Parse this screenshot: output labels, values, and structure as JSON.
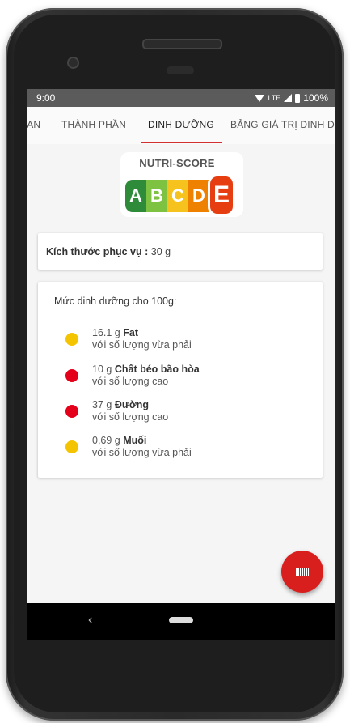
{
  "status_bar": {
    "time": "9:00",
    "network": "LTE",
    "battery": "100%"
  },
  "tabs": [
    {
      "label": "JAN"
    },
    {
      "label": "THÀNH PHẦN"
    },
    {
      "label": "DINH DƯỠNG",
      "active": true
    },
    {
      "label": "BẢNG GIÁ TRỊ DINH DƯ"
    }
  ],
  "nutriscore": {
    "title": "NUTRI-SCORE",
    "grades": [
      "A",
      "B",
      "C",
      "D",
      "E"
    ],
    "selected": "E"
  },
  "serving": {
    "label": "Kích thước phục vụ :",
    "value": "30 g"
  },
  "levels": {
    "title": "Mức dinh dưỡng cho 100g:",
    "items": [
      {
        "amount": "16.1 g",
        "nutrient": "Fat",
        "level_text": "với số lượng vừa phải",
        "level": "moderate",
        "color": "#f5c400"
      },
      {
        "amount": "10 g",
        "nutrient": "Chất béo bão hòa",
        "level_text": "với số lượng cao",
        "level": "high",
        "color": "#e4001b"
      },
      {
        "amount": "37 g",
        "nutrient": "Đường",
        "level_text": "với số lượng cao",
        "level": "high",
        "color": "#e4001b"
      },
      {
        "amount": "0,69 g",
        "nutrient": "Muối",
        "level_text": "với số lượng vừa phải",
        "level": "moderate",
        "color": "#f5c400"
      }
    ]
  },
  "fab": {
    "icon": "barcode-icon",
    "color": "#d91e1e"
  },
  "navbar": {
    "back_icon": "back-icon",
    "home_icon": "home-pill-icon"
  }
}
